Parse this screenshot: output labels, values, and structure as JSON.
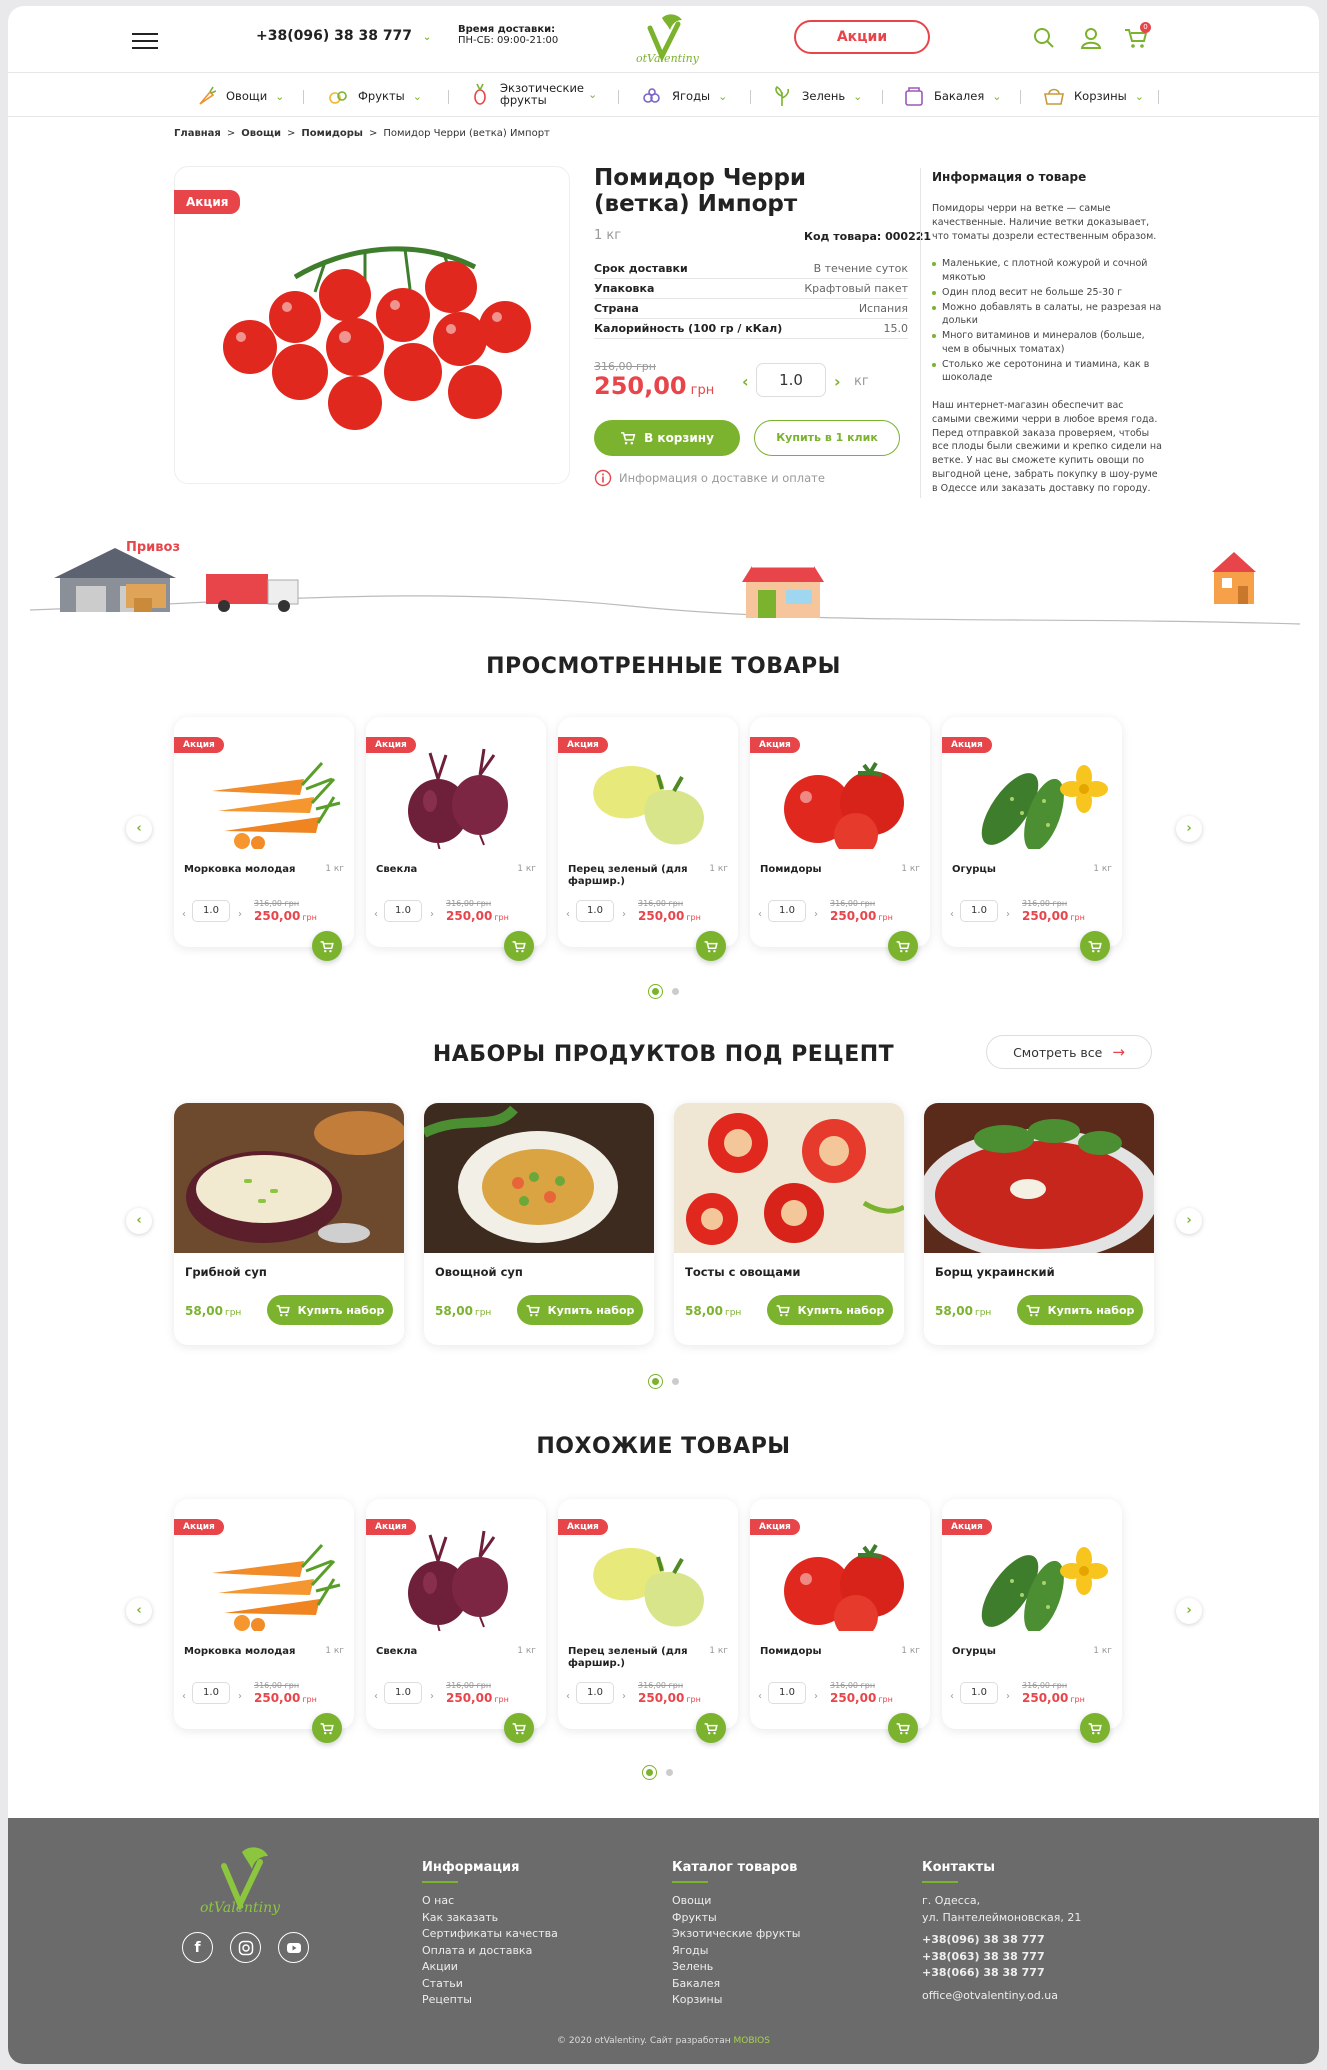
{
  "header": {
    "phone": "+38(096) 38 38 777",
    "delivery_label": "Время доставки:",
    "delivery_hours": "ПН-СБ: 09:00-21:00",
    "logo_text": "ot Valentiny",
    "promo_button": "Акции",
    "cart_count": "0"
  },
  "categories": [
    {
      "label": "Овощи",
      "icon": "carrot-icon"
    },
    {
      "label": "Фрукты",
      "icon": "fruit-icon"
    },
    {
      "label": "Экзотические фрукты",
      "icon": "pineapple-icon"
    },
    {
      "label": "Ягоды",
      "icon": "berry-icon"
    },
    {
      "label": "Зелень",
      "icon": "herb-icon"
    },
    {
      "label": "Бакалея",
      "icon": "groceries-icon"
    },
    {
      "label": "Корзины",
      "icon": "basket-icon"
    }
  ],
  "breadcrumbs": [
    "Главная",
    "Овощи",
    "Помидоры",
    "Помидор Черри (ветка) Импорт"
  ],
  "product": {
    "badge": "Акция",
    "title": "Помидор Черри (ветка) Импорт",
    "weight": "1 кг",
    "code": "Код товара: 000221",
    "specs": [
      {
        "key": "Срок доставки",
        "value": "В течение суток"
      },
      {
        "key": "Упаковка",
        "value": "Крафтовый пакет"
      },
      {
        "key": "Страна",
        "value": "Испания"
      },
      {
        "key": "Калорийность (100 гр / кКал)",
        "value": "15.0"
      }
    ],
    "old_price": "316,00 грн",
    "price": "250,00",
    "currency": "грн",
    "qty": "1.0",
    "unit": "кг",
    "add_to_cart": "В корзину",
    "buy_one_click": "Купить в 1 клик",
    "delivery_info": "Информация о доставке и оплате"
  },
  "product_info": {
    "title": "Информация о товаре",
    "intro": "Помидоры черри на ветке — самые качественные. Наличие ветки доказывает, что томаты дозрели естественным образом.",
    "bullets": [
      "Маленькие, с плотной кожурой и сочной мякотью",
      "Один плод весит не больше 25-30 г",
      "Можно добавлять в салаты, не разрезая на дольки",
      "Много витаминов и минералов (больше, чем в обычных томатах)",
      "Столько же серотонина и тиамина, как в шоколаде"
    ],
    "outro": "Наш интернет-магазин обеспечит вас самыми свежими черри в любое время года. Перед отправкой заказа проверяем, чтобы все плоды были свежими и крепко сидели на ветке. У нас вы сможете купить овощи по выгодной цене, забрать покупку в шоу-руме в Одессе или заказать доставку по городу."
  },
  "banner": {
    "market_sign": "Привоз"
  },
  "viewed": {
    "title": "ПРОСМОТРЕННЫЕ ТОВАРЫ",
    "items": [
      {
        "badge": "Акция",
        "name": "Морковка молодая",
        "weight": "1 кг",
        "qty": "1.0",
        "old_price": "316,00 грн",
        "price": "250,00",
        "currency": "грн",
        "image": "carrot-image"
      },
      {
        "badge": "Акция",
        "name": "Свекла",
        "weight": "1 кг",
        "qty": "1.0",
        "old_price": "316,00 грн",
        "price": "250,00",
        "currency": "грн",
        "image": "beet-image"
      },
      {
        "badge": "Акция",
        "name": "Перец зеленый (для фаршир.)",
        "weight": "1 кг",
        "qty": "1.0",
        "old_price": "316,00 грн",
        "price": "250,00",
        "currency": "грн",
        "image": "pepper-image"
      },
      {
        "badge": "Акция",
        "name": "Помидоры",
        "weight": "1 кг",
        "qty": "1.0",
        "old_price": "316,00 грн",
        "price": "250,00",
        "currency": "грн",
        "image": "tomato-image"
      },
      {
        "badge": "Акция",
        "name": "Огурцы",
        "weight": "1 кг",
        "qty": "1.0",
        "old_price": "316,00 грн",
        "price": "250,00",
        "currency": "грн",
        "image": "cucumber-image"
      }
    ]
  },
  "recipes": {
    "title": "НАБОРЫ ПРОДУКТОВ ПОД РЕЦЕПТ",
    "see_all": "Смотреть все",
    "items": [
      {
        "name": "Грибной суп",
        "price": "58,00",
        "currency": "грн",
        "button": "Купить набор",
        "image": "mushroom-soup-image"
      },
      {
        "name": "Овощной суп",
        "price": "58,00",
        "currency": "грн",
        "button": "Купить набор",
        "image": "vegetable-soup-image"
      },
      {
        "name": "Тосты с овощами",
        "price": "58,00",
        "currency": "грн",
        "button": "Купить набор",
        "image": "toast-image"
      },
      {
        "name": "Борщ украинский",
        "price": "58,00",
        "currency": "грн",
        "button": "Купить набор",
        "image": "borscht-image"
      }
    ]
  },
  "similar": {
    "title": "ПОХОЖИЕ ТОВАРЫ",
    "items": [
      {
        "badge": "Акция",
        "name": "Морковка молодая",
        "weight": "1 кг",
        "qty": "1.0",
        "old_price": "316,00 грн",
        "price": "250,00",
        "currency": "грн",
        "image": "carrot-image"
      },
      {
        "badge": "Акция",
        "name": "Свекла",
        "weight": "1 кг",
        "qty": "1.0",
        "old_price": "316,00 грн",
        "price": "250,00",
        "currency": "грн",
        "image": "beet-image"
      },
      {
        "badge": "Акция",
        "name": "Перец зеленый (для фаршир.)",
        "weight": "1 кг",
        "qty": "1.0",
        "old_price": "316,00 грн",
        "price": "250,00",
        "currency": "грн",
        "image": "pepper-image"
      },
      {
        "badge": "Акция",
        "name": "Помидоры",
        "weight": "1 кг",
        "qty": "1.0",
        "old_price": "316,00 грн",
        "price": "250,00",
        "currency": "грн",
        "image": "tomato-image"
      },
      {
        "badge": "Акция",
        "name": "Огурцы",
        "weight": "1 кг",
        "qty": "1.0",
        "old_price": "316,00 грн",
        "price": "250,00",
        "currency": "грн",
        "image": "cucumber-image"
      }
    ]
  },
  "footer": {
    "info_title": "Информация",
    "info_links": [
      "О нас",
      "Как заказать",
      "Сертификаты качества",
      "Оплата и доставка",
      "Акции",
      "Статьи",
      "Рецепты"
    ],
    "catalog_title": "Каталог товаров",
    "catalog_links": [
      "Овощи",
      "Фрукты",
      "Экзотические фрукты",
      "Ягоды",
      "Зелень",
      "Бакалея",
      "Корзины"
    ],
    "contacts_title": "Контакты",
    "city": "г. Одесса,",
    "street": "ул. Пантелеймоновская, 21",
    "phones": [
      "+38(096) 38 38 777",
      "+38(063) 38 38 777",
      "+38(066) 38 38 777"
    ],
    "email": "office@otvalentiny.od.ua",
    "copyright": "© 2020 otValentiny. Сайт разработан",
    "developer": "MOBIOS"
  },
  "colors": {
    "accent": "#7bb22e",
    "sale": "#e8454b",
    "footer": "#6b6b6b"
  }
}
